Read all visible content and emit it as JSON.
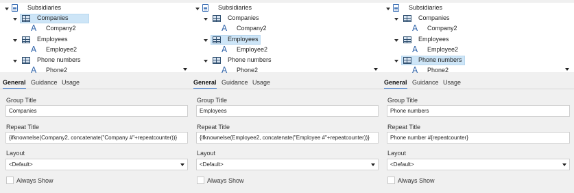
{
  "panels": [
    {
      "tree": {
        "root": "Subsidiaries",
        "groups": [
          {
            "label": "Companies",
            "child": "Company2",
            "selected": true
          },
          {
            "label": "Employees",
            "child": "Employee2",
            "selected": false
          },
          {
            "label": "Phone numbers",
            "child": "Phone2",
            "selected": false
          }
        ]
      },
      "tabs": [
        "General",
        "Guidance",
        "Usage"
      ],
      "form": {
        "group_title_label": "Group Title",
        "group_title_value": "Companies",
        "repeat_title_label": "Repeat Title",
        "repeat_title_value": "{ifknownelse(Company2, concatenate(\"Company #\"+repeatcounter))}",
        "layout_label": "Layout",
        "layout_value": "<Default>",
        "always_show_label": "Always Show"
      }
    },
    {
      "tree": {
        "root": "Subsidiaries",
        "groups": [
          {
            "label": "Companies",
            "child": "Company2",
            "selected": false
          },
          {
            "label": "Employees",
            "child": "Employee2",
            "selected": true
          },
          {
            "label": "Phone numbers",
            "child": "Phone2",
            "selected": false
          }
        ]
      },
      "tabs": [
        "General",
        "Guidance",
        "Usage"
      ],
      "form": {
        "group_title_label": "Group Title",
        "group_title_value": "Employees",
        "repeat_title_label": "Repeat Title",
        "repeat_title_value": "{ifknownelse(Employee2, concatenate(\"Employee #\"+repeatcounter))}",
        "layout_label": "Layout",
        "layout_value": "<Default>",
        "always_show_label": "Always Show"
      }
    },
    {
      "tree": {
        "root": "Subsidiaries",
        "groups": [
          {
            "label": "Companies",
            "child": "Company2",
            "selected": false
          },
          {
            "label": "Employees",
            "child": "Employee2",
            "selected": false
          },
          {
            "label": "Phone numbers",
            "child": "Phone2",
            "selected": true
          }
        ]
      },
      "tabs": [
        "General",
        "Guidance",
        "Usage"
      ],
      "form": {
        "group_title_label": "Group Title",
        "group_title_value": "Phone numbers",
        "repeat_title_label": "Repeat Title",
        "repeat_title_value": "Phone number #{repeatcounter}",
        "layout_label": "Layout",
        "layout_value": "<Default>",
        "always_show_label": "Always Show"
      }
    }
  ],
  "icons": {
    "root": "document-icon",
    "group": "repeat-group-icon",
    "child": "text-field-icon",
    "expander": "expand-arrow-icon"
  }
}
